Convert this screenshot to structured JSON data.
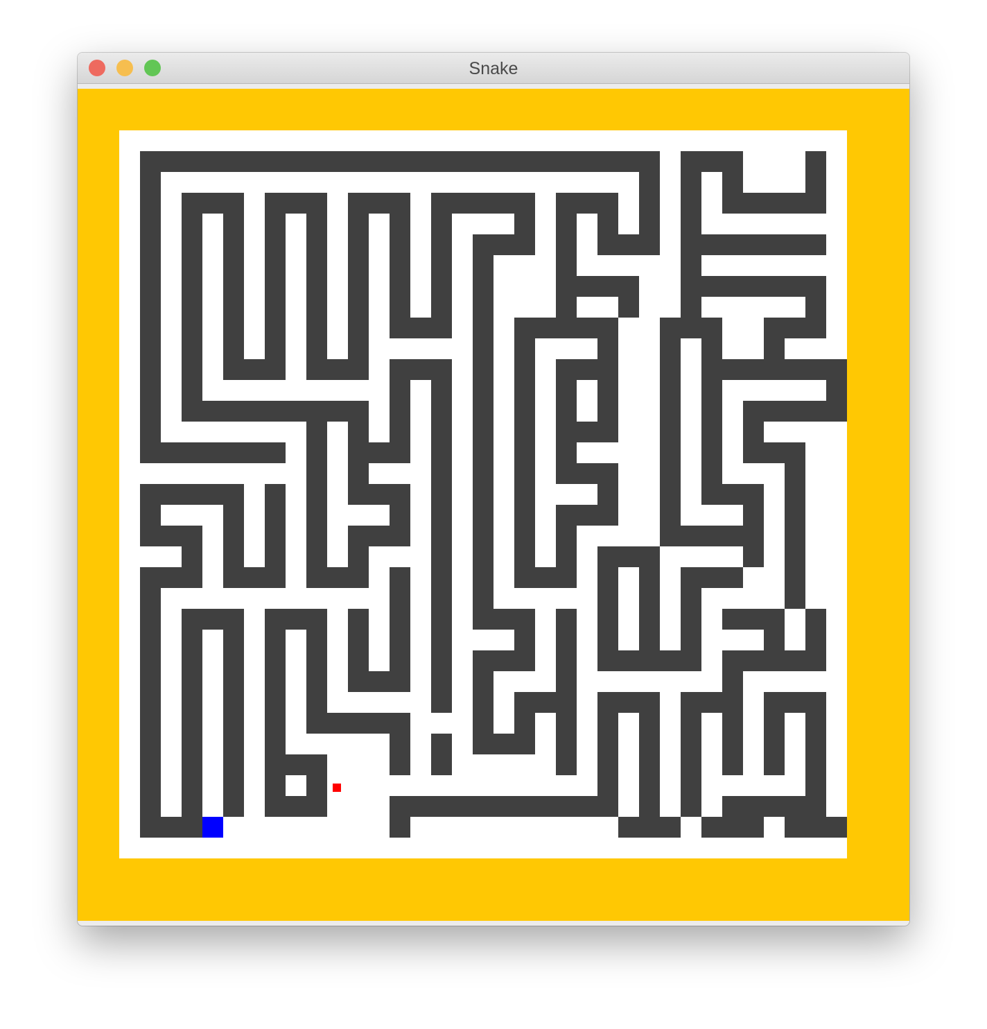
{
  "window": {
    "title": "Snake",
    "controls": [
      {
        "name": "close",
        "color": "#ee6a5f"
      },
      {
        "name": "minimize",
        "color": "#f6be4f"
      },
      {
        "name": "maximize",
        "color": "#62c655"
      }
    ]
  },
  "game": {
    "colors": {
      "border": "#ffc803",
      "floor": "#ffffff",
      "wall": "#404040",
      "player": "#0000ff",
      "food": "#ff0000"
    },
    "grid_size": 35,
    "player_cell": [
      4,
      33
    ],
    "food_cell": [
      10,
      31
    ],
    "maze_rows": [
      "...................................",
      ".#########################.###...#.",
      ".#.......................#.#.#...#.",
      ".#.###.###.###.#####.###.#.#.#####.",
      ".#.#.#.#.#.#.#.#...#.#.#.#.#.......",
      ".#.#.#.#.#.#.#.#.###.#.###.#######.",
      ".#.#.#.#.#.#.#.#.#...#.....#.......",
      ".#.#.#.#.#.#.#.#.#...####..#######.",
      ".#.#.#.#.#.#.#.#.#...#..#..#.....#.",
      ".#.#.#.#.#.#.###.#.#####..###..###.",
      ".#.#.#.#.#.#.....#.#...#..#.#..#...",
      ".#.#.###.###.###.#.#.###..#.#######",
      ".#.#.........#.#.#.#.#.#..#.#.....#",
      ".#.#########.#.#.#.#.#.#..#.#.#####",
      ".#.......#.#.#.#.#.#.###..#.#.#....",
      ".#######.#.###.#.#.#.#....#.#.###..",
      ".........#.#...#.#.#.###..#.#...#..",
      ".#####.#.#.###.#.#.#...#..#.###.#..",
      ".#...#.#.#...#.#.#.#.###..#...#.#..",
      ".###.#.#.#.###.#.#.#.#....#####.#..",
      "...#.#.#.#.#...#.#.#.#.###....#.#..",
      ".###.###.###.#.#.#.###.#.#.###..#..",
      ".#...........#.#.#.....#.#.#....#..",
      ".#.###.###.#.#.#.###.#.#.#.#.###.#.",
      ".#.#.#.#.#.#.#.#...#.#.#.#.#...#.#.",
      ".#.#.#.#.#.#.#.#.###.#.#####.#####.",
      ".#.#.#.#.#.###.#.#...#.......#.....",
      ".#.#.#.#.#.....#.#.###.###.###.###.",
      ".#.#.#.#.#####...#.#.#.#.#.#.#.#.#.",
      ".#.#.#.#.....#.#.###.#.#.#.#.#.#.#.",
      ".#.#.#.###...#.#.....#.#.#.#.#.#.#.",
      ".#.#.#.#.#.............#.#.#.....#.",
      ".#.#.#.###...###########.#.#.#####.",
      ".###.........#..........###.###.###",
      "..................................."
    ]
  }
}
